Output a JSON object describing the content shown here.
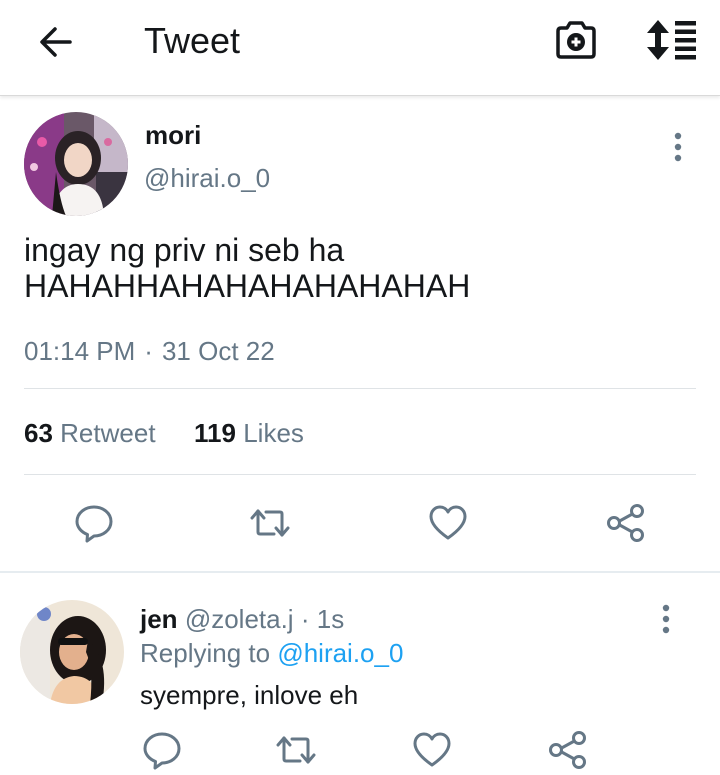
{
  "header": {
    "title": "Tweet"
  },
  "tweet": {
    "author_name": "mori",
    "author_handle": "@hirai.o_0",
    "text": "ingay ng priv ni seb ha\nHAHAHHAHAHAHAHAHAHAH",
    "time": "01:14 PM",
    "separator": "·",
    "date": "31 Oct 22",
    "retweet_count": "63",
    "retweet_label": "Retweet",
    "like_count": "119",
    "like_label": "Likes"
  },
  "actions": [
    "reply-icon",
    "retweet-icon",
    "like-icon",
    "share-icon"
  ],
  "reply": {
    "author_name": "jen",
    "author_handle": "@zoleta.j",
    "separator": "·",
    "age": "1s",
    "replying_prefix": "Replying to",
    "replying_to": "@hirai.o_0",
    "text": "syempre, inlove eh"
  },
  "colors": {
    "text": "#14171a",
    "muted": "#657786",
    "link": "#1da1f2",
    "divider": "#dfe3e6"
  }
}
